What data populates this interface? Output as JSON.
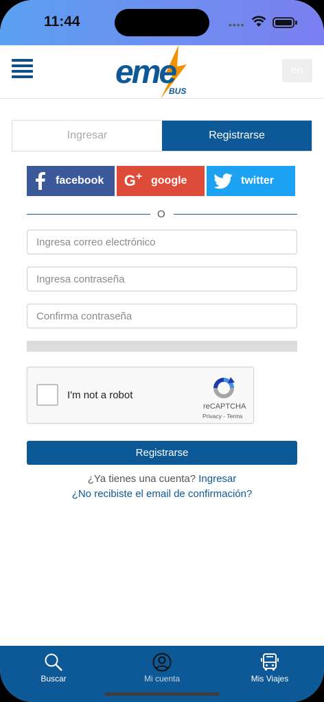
{
  "status": {
    "time": "11:44"
  },
  "header": {
    "logo_main": "eme",
    "logo_sub": "BUS",
    "lang_button": "en"
  },
  "auth_tabs": {
    "login": "Ingresar",
    "register": "Registrarse"
  },
  "social": {
    "facebook": "facebook",
    "google": "google",
    "twitter": "twitter"
  },
  "separator": "O",
  "form": {
    "email_placeholder": "Ingresa correo electrónico",
    "password_placeholder": "Ingresa contraseña",
    "confirm_placeholder": "Confirma contraseña"
  },
  "captcha": {
    "label": "I'm not a robot",
    "brand": "reCAPTCHA",
    "links": "Privacy - Terms"
  },
  "submit_label": "Registrarse",
  "footer": {
    "have_account": "¿Ya tienes una cuenta?",
    "login_link": "Ingresar",
    "resend_link": "¿No recibiste el email de confirmación?"
  },
  "bottom_nav": [
    {
      "label": "Buscar",
      "icon": "search-icon"
    },
    {
      "label": "Mi cuenta",
      "icon": "user-circle-icon"
    },
    {
      "label": "Mis Viajes",
      "icon": "bus-icon"
    }
  ],
  "colors": {
    "primary": "#0d5896",
    "facebook": "#3b5998",
    "google": "#dd4b39",
    "twitter": "#1da1f2",
    "logo_orange": "#f39200"
  }
}
